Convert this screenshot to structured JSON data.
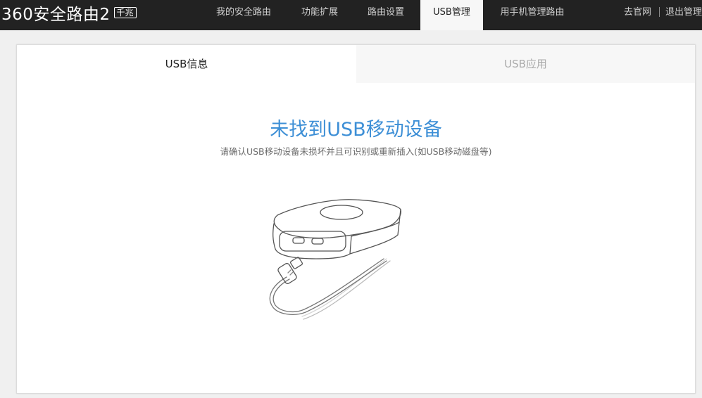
{
  "header": {
    "logo_text": "360安全路由2",
    "logo_badge": "千兆",
    "nav": [
      {
        "label": "我的安全路由"
      },
      {
        "label": "功能扩展"
      },
      {
        "label": "路由设置"
      },
      {
        "label": "USB管理",
        "active": true
      },
      {
        "label": "用手机管理路由"
      }
    ],
    "right_links": [
      {
        "label": "去官网"
      },
      {
        "label": "退出管理"
      }
    ]
  },
  "tabs": [
    {
      "label": "USB信息",
      "active": true
    },
    {
      "label": "USB应用",
      "active": false
    }
  ],
  "empty_state": {
    "title": "未找到USB移动设备",
    "description": "请确认USB移动设备未损坏并且可识别或重新插入(如USB移动磁盘等)",
    "illustration": "usb-drive-illustration"
  },
  "colors": {
    "topbar": "#222222",
    "accent": "#3d8fd6",
    "active_tab_bg": "#f7f7f7"
  }
}
